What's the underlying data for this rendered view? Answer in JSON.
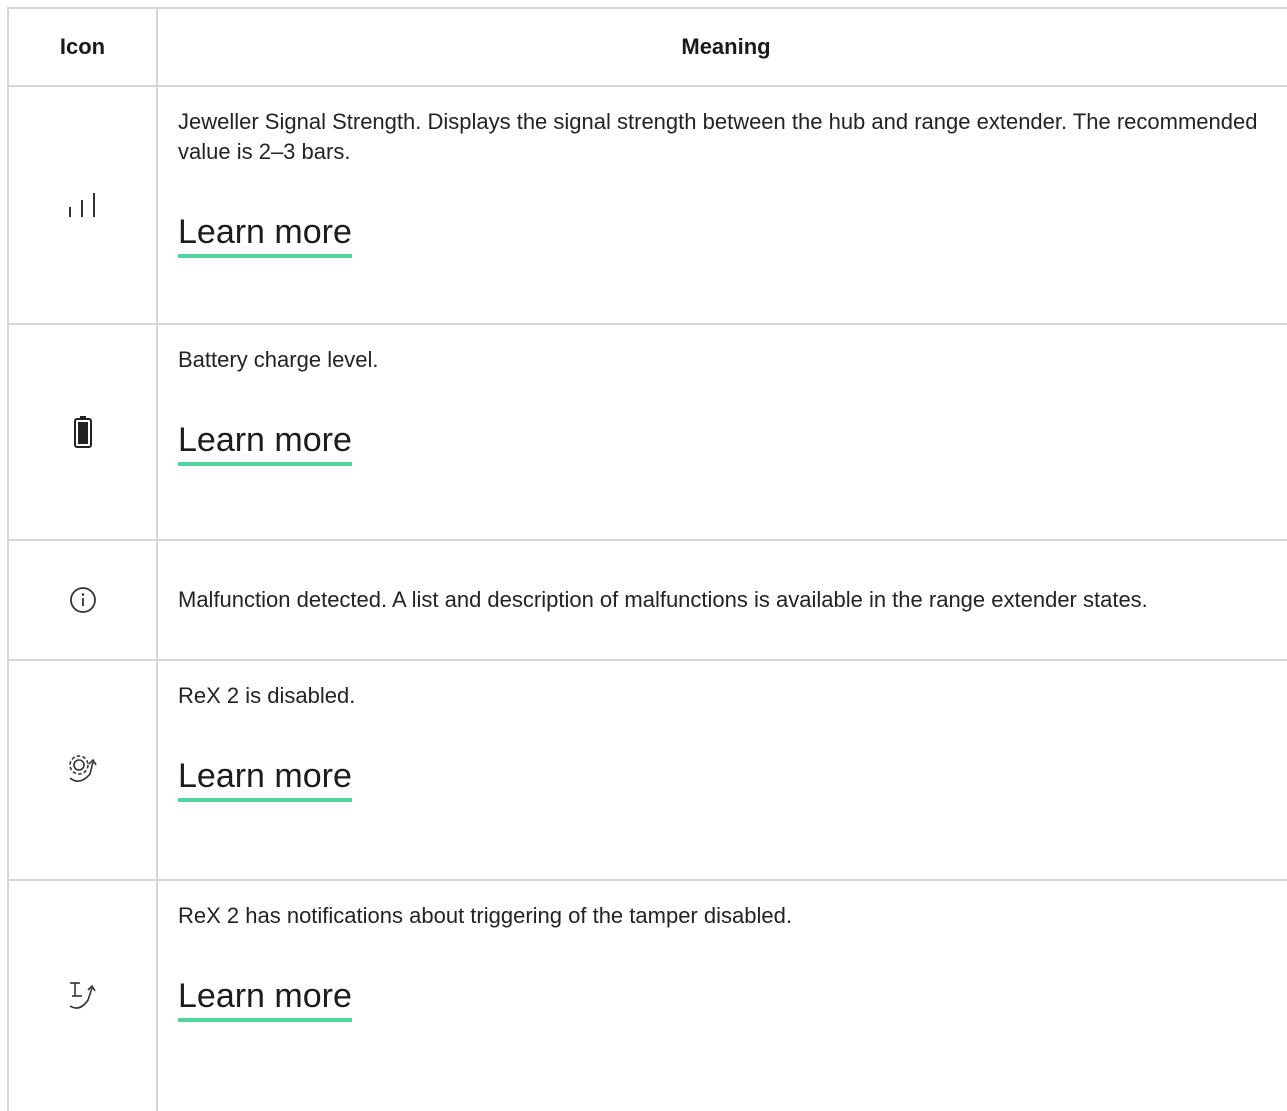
{
  "table": {
    "headers": {
      "icon": "Icon",
      "meaning": "Meaning"
    },
    "rows": [
      {
        "icon": "signal-strength-icon",
        "text": "Jeweller Signal Strength. Displays the signal strength between the hub and range extender. The recommended value is 2–3 bars.",
        "link": "Learn more"
      },
      {
        "icon": "battery-icon",
        "text": "Battery charge level.",
        "link": "Learn more"
      },
      {
        "icon": "info-icon",
        "text": "Malfunction detected. A list and description of malfunctions is available in the range extender states."
      },
      {
        "icon": "gear-disabled-icon",
        "text": "ReX 2 is disabled.",
        "link": "Learn more"
      },
      {
        "icon": "tamper-disabled-icon",
        "text": "ReX 2 has notifications about triggering of the tamper disabled.",
        "link": "Learn more"
      }
    ]
  },
  "colors": {
    "link_underline": "#4cd89b",
    "border": "#d6d6d6"
  }
}
